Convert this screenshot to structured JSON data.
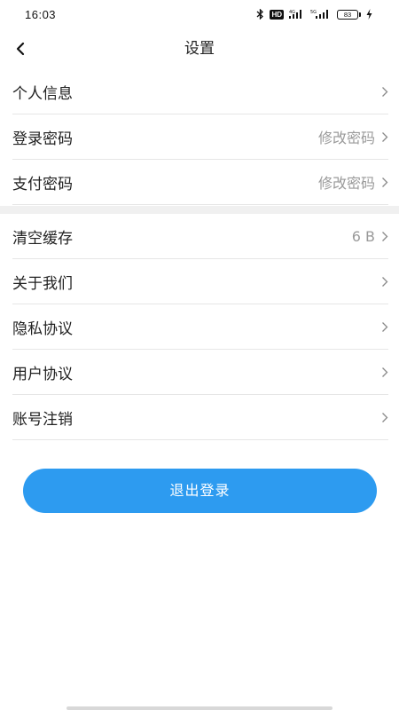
{
  "status_bar": {
    "time": "16:03",
    "hd_label": "HD",
    "battery_level": "83",
    "icons": [
      "bluetooth-icon",
      "hd-icon",
      "signal-4g-icon",
      "signal-5g-icon",
      "battery-icon",
      "charging-icon"
    ]
  },
  "header": {
    "title": "设置",
    "back_icon": "chevron-left-icon"
  },
  "group1": {
    "items": [
      {
        "label": "个人信息",
        "value": ""
      },
      {
        "label": "登录密码",
        "value": "修改密码"
      },
      {
        "label": "支付密码",
        "value": "修改密码"
      }
    ]
  },
  "group2": {
    "items": [
      {
        "label": "清空缓存",
        "value": "6 B"
      },
      {
        "label": "关于我们",
        "value": ""
      },
      {
        "label": "隐私协议",
        "value": ""
      },
      {
        "label": "用户协议",
        "value": ""
      },
      {
        "label": "账号注销",
        "value": ""
      }
    ]
  },
  "logout": {
    "label": "退出登录"
  },
  "colors": {
    "accent": "#2d9bf0",
    "divider": "#e6e6e6",
    "section_gap": "#f0f0f0",
    "value_text": "#9a9a9a"
  }
}
